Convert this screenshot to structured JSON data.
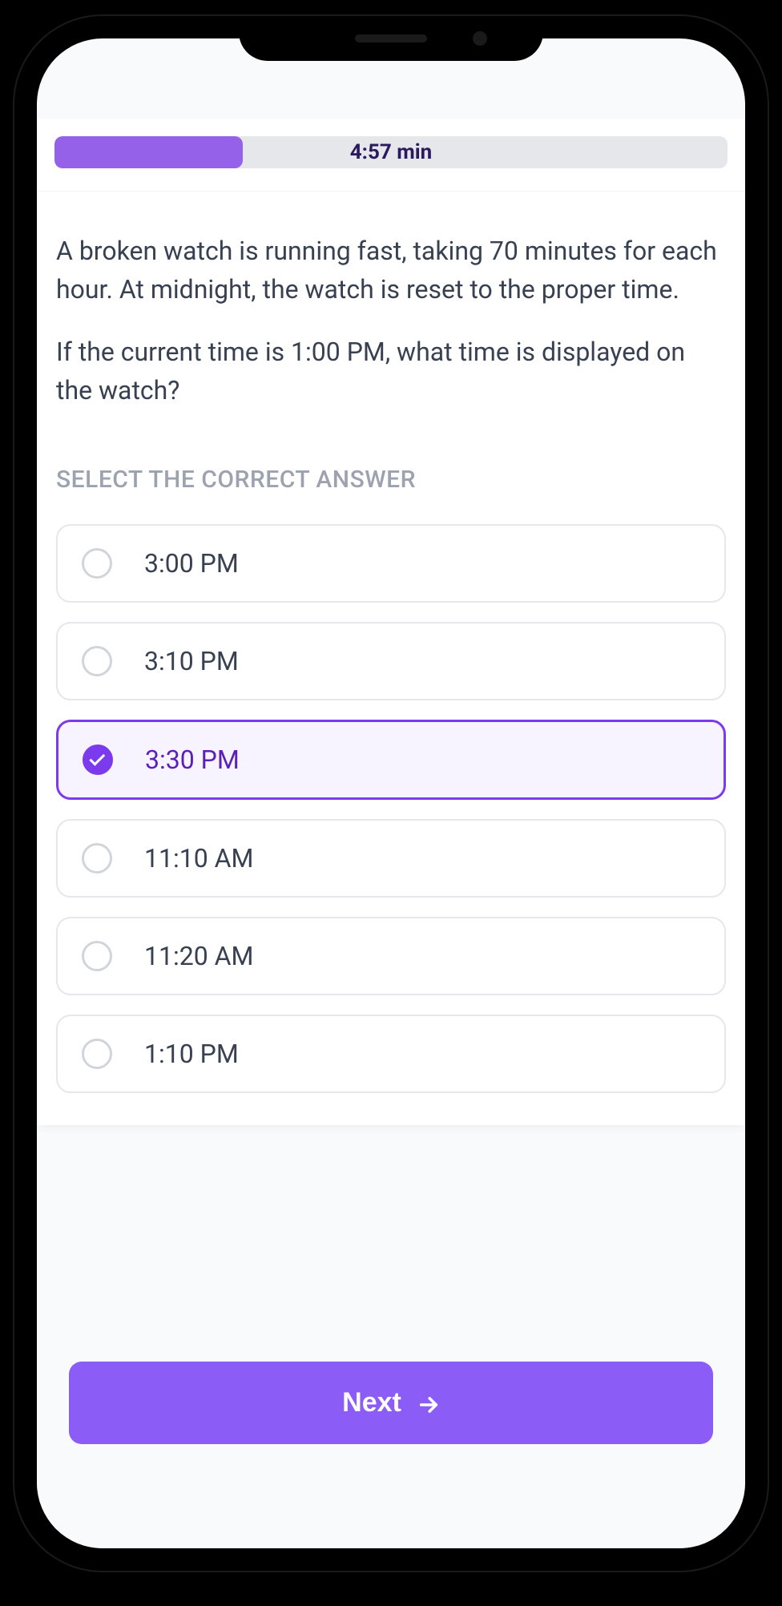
{
  "timer": {
    "display": "4:57 min",
    "progress_percent": 28
  },
  "question": {
    "paragraph1": "A broken watch is running fast, taking 70 minutes for each hour. At midnight, the watch is reset to the proper time.",
    "paragraph2": "If the current time is 1:00 PM, what time is displayed on the watch?"
  },
  "answers": {
    "label": "SELECT THE CORRECT ANSWER",
    "options": [
      {
        "text": "3:00 PM",
        "selected": false
      },
      {
        "text": "3:10 PM",
        "selected": false
      },
      {
        "text": "3:30 PM",
        "selected": true
      },
      {
        "text": "11:10 AM",
        "selected": false
      },
      {
        "text": "11:20 AM",
        "selected": false
      },
      {
        "text": "1:10 PM",
        "selected": false
      }
    ]
  },
  "footer": {
    "next_label": "Next"
  }
}
